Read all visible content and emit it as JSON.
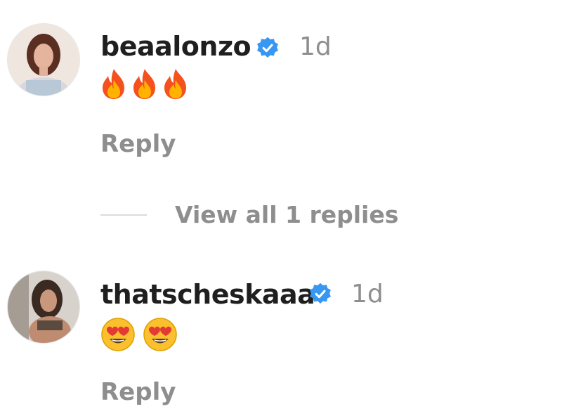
{
  "comments": [
    {
      "username": "beaalonzo",
      "time": "1d",
      "emoji_icons": [
        "fire-emoji",
        "fire-emoji",
        "fire-emoji"
      ],
      "reply_label": "Reply"
    },
    {
      "username": "thatscheskaaa",
      "time": "1d",
      "emoji_icons": [
        "heart-eyes-emoji",
        "heart-eyes-emoji"
      ],
      "reply_label": "Reply"
    }
  ],
  "view_replies_label": "View all 1 replies",
  "colors": {
    "verified": "#3897f0",
    "muted": "#8e8e8e",
    "text": "#1f1f1f"
  },
  "icons": {
    "verified": "verified-badge-icon",
    "avatar": "avatar"
  }
}
